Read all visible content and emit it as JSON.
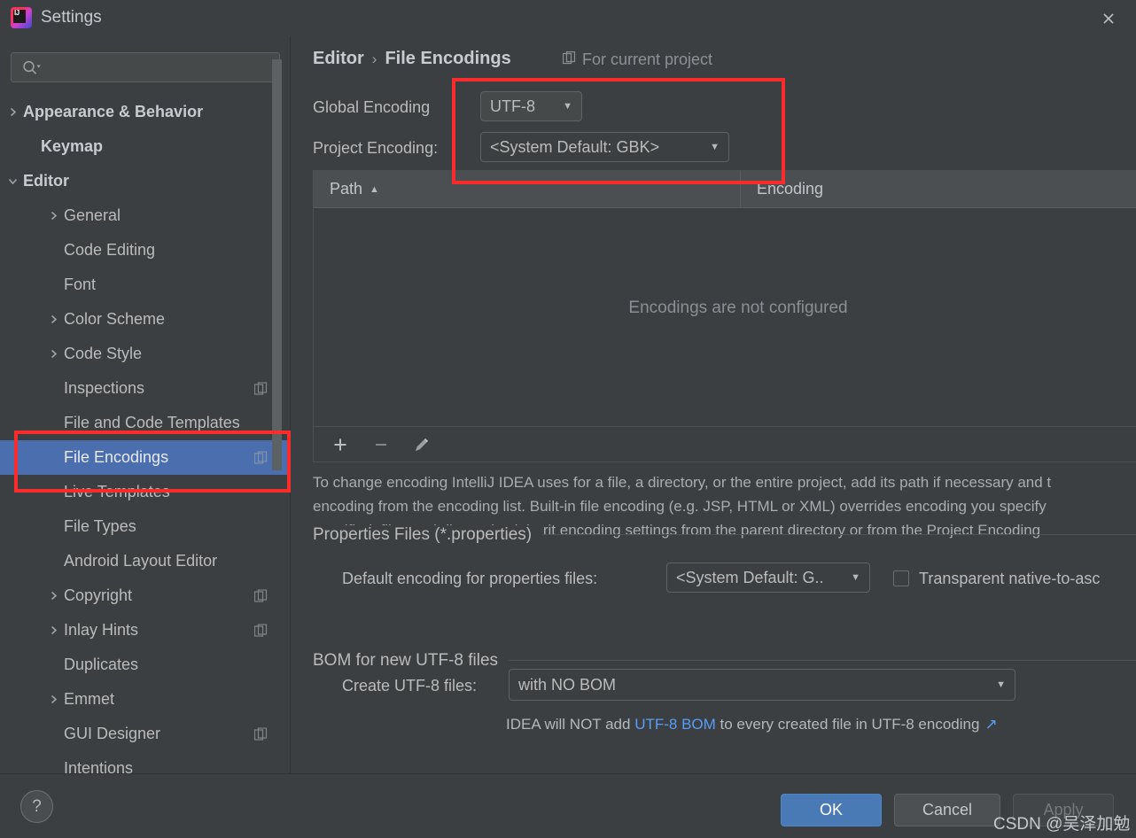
{
  "window": {
    "title": "Settings",
    "logo_icon": "intellij-idea-logo",
    "close_icon": "close-icon"
  },
  "sidebar": {
    "search": {
      "placeholder": "",
      "value": "",
      "icon": "search-icon"
    },
    "items": [
      {
        "label": "Appearance & Behavior",
        "indent": 26,
        "arrow": "chevron-right",
        "bold": true,
        "badge": false,
        "selected": false
      },
      {
        "label": "Keymap",
        "indent": 46,
        "arrow": "",
        "bold": true,
        "badge": false,
        "selected": false
      },
      {
        "label": "Editor",
        "indent": 26,
        "arrow": "chevron-down",
        "bold": true,
        "badge": false,
        "selected": false
      },
      {
        "label": "General",
        "indent": 72,
        "arrow": "chevron-right",
        "bold": false,
        "badge": false,
        "selected": false
      },
      {
        "label": "Code Editing",
        "indent": 72,
        "arrow": "",
        "bold": false,
        "badge": false,
        "selected": false
      },
      {
        "label": "Font",
        "indent": 72,
        "arrow": "",
        "bold": false,
        "badge": false,
        "selected": false
      },
      {
        "label": "Color Scheme",
        "indent": 72,
        "arrow": "chevron-right",
        "bold": false,
        "badge": false,
        "selected": false
      },
      {
        "label": "Code Style",
        "indent": 72,
        "arrow": "chevron-right",
        "bold": false,
        "badge": false,
        "selected": false
      },
      {
        "label": "Inspections",
        "indent": 72,
        "arrow": "",
        "bold": false,
        "badge": true,
        "selected": false
      },
      {
        "label": "File and Code Templates",
        "indent": 72,
        "arrow": "",
        "bold": false,
        "badge": false,
        "selected": false
      },
      {
        "label": "File Encodings",
        "indent": 72,
        "arrow": "",
        "bold": false,
        "badge": true,
        "selected": true
      },
      {
        "label": "Live Templates",
        "indent": 72,
        "arrow": "",
        "bold": false,
        "badge": false,
        "selected": false
      },
      {
        "label": "File Types",
        "indent": 72,
        "arrow": "",
        "bold": false,
        "badge": false,
        "selected": false
      },
      {
        "label": "Android Layout Editor",
        "indent": 72,
        "arrow": "",
        "bold": false,
        "badge": false,
        "selected": false
      },
      {
        "label": "Copyright",
        "indent": 72,
        "arrow": "chevron-right",
        "bold": false,
        "badge": true,
        "selected": false
      },
      {
        "label": "Inlay Hints",
        "indent": 72,
        "arrow": "chevron-right",
        "bold": false,
        "badge": true,
        "selected": false
      },
      {
        "label": "Duplicates",
        "indent": 72,
        "arrow": "",
        "bold": false,
        "badge": false,
        "selected": false
      },
      {
        "label": "Emmet",
        "indent": 72,
        "arrow": "chevron-right",
        "bold": false,
        "badge": false,
        "selected": false
      },
      {
        "label": "GUI Designer",
        "indent": 72,
        "arrow": "",
        "bold": false,
        "badge": true,
        "selected": false
      },
      {
        "label": "Intentions",
        "indent": 72,
        "arrow": "",
        "bold": false,
        "badge": false,
        "selected": false
      }
    ]
  },
  "main": {
    "breadcrumb": {
      "parent": "Editor",
      "separator": "›",
      "current": "File Encodings"
    },
    "for_current_project": {
      "label": "For current project",
      "icon": "copy-scope-icon"
    },
    "global_encoding": {
      "label": "Global Encoding",
      "value": "UTF-8"
    },
    "project_encoding": {
      "label": "Project Encoding:",
      "value": "<System Default: GBK>"
    },
    "table": {
      "columns": [
        "Path",
        "Encoding"
      ],
      "sort_indicator": "▲",
      "rows": [],
      "empty_message": "Encodings are not configured",
      "toolbar": [
        {
          "icon": "add-icon",
          "label": "+"
        },
        {
          "icon": "remove-icon",
          "label": "−"
        },
        {
          "icon": "edit-pencil-icon",
          "label": "✎"
        }
      ]
    },
    "description_lines": [
      "To change encoding IntelliJ IDEA uses for a file, a directory, or the entire project, add its path if necessary and t",
      "encoding from the encoding list. Built-in file encoding (e.g. JSP, HTML or XML) overrides encoding you specify",
      "specified, files and directories inherit encoding settings from the parent directory or from the Project Encoding"
    ],
    "properties_group": {
      "title": "Properties Files (*.properties)",
      "default_encoding_label": "Default encoding for properties files:",
      "default_encoding_value": "<System Default: G..",
      "transparent_checkbox": {
        "label": "Transparent native-to-asc",
        "checked": false
      }
    },
    "bom_group": {
      "title": "BOM for new UTF-8 files",
      "create_label": "Create UTF-8 files:",
      "create_value": "with NO BOM",
      "hint_prefix": "IDEA will NOT add ",
      "hint_link": "UTF-8 BOM",
      "hint_suffix": " to every created file in UTF-8 encoding",
      "hint_external_icon": "↗"
    }
  },
  "footer": {
    "help_icon": "?",
    "ok_label": "OK",
    "cancel_label": "Cancel",
    "apply_label": "Apply"
  },
  "watermark": {
    "text": "CSDN @吴泽加勉"
  },
  "colors": {
    "background": "#3c3f41",
    "selection_blue": "#4b6eaf",
    "annotation_red": "#fd2c2c",
    "link_blue": "#589df6",
    "primary_button": "#4a7ab5"
  }
}
